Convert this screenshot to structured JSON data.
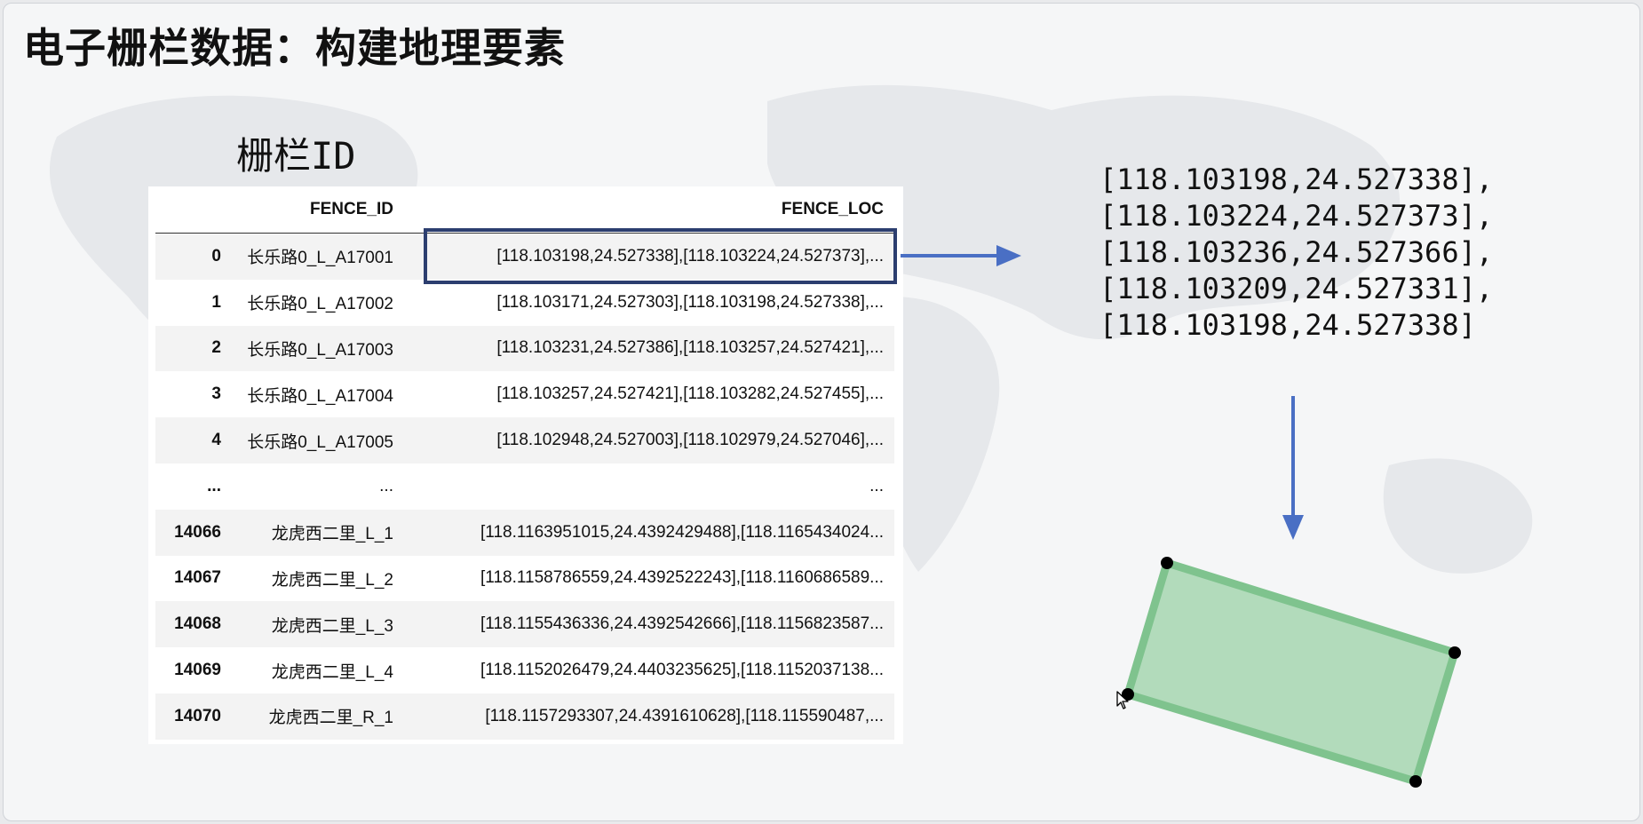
{
  "slide": {
    "title": "电子栅栏数据：构建地理要素",
    "fence_label": "栅栏ID"
  },
  "table": {
    "columns": [
      "",
      "FENCE_ID",
      "FENCE_LOC"
    ],
    "rows": [
      {
        "index": "0",
        "fence_id": "长乐路0_L_A17001",
        "fence_loc": "[118.103198,24.527338],[118.103224,24.527373],..."
      },
      {
        "index": "1",
        "fence_id": "长乐路0_L_A17002",
        "fence_loc": "[118.103171,24.527303],[118.103198,24.527338],..."
      },
      {
        "index": "2",
        "fence_id": "长乐路0_L_A17003",
        "fence_loc": "[118.103231,24.527386],[118.103257,24.527421],..."
      },
      {
        "index": "3",
        "fence_id": "长乐路0_L_A17004",
        "fence_loc": "[118.103257,24.527421],[118.103282,24.527455],..."
      },
      {
        "index": "4",
        "fence_id": "长乐路0_L_A17005",
        "fence_loc": "[118.102948,24.527003],[118.102979,24.527046],..."
      },
      {
        "index": "...",
        "fence_id": "...",
        "fence_loc": "..."
      },
      {
        "index": "14066",
        "fence_id": "龙虎西二里_L_1",
        "fence_loc": "[118.1163951015,24.4392429488],[118.1165434024..."
      },
      {
        "index": "14067",
        "fence_id": "龙虎西二里_L_2",
        "fence_loc": "[118.1158786559,24.4392522243],[118.1160686589..."
      },
      {
        "index": "14068",
        "fence_id": "龙虎西二里_L_3",
        "fence_loc": "[118.1155436336,24.4392542666],[118.1156823587..."
      },
      {
        "index": "14069",
        "fence_id": "龙虎西二里_L_4",
        "fence_loc": "[118.1152026479,24.4403235625],[118.1152037138..."
      },
      {
        "index": "14070",
        "fence_id": "龙虎西二里_R_1",
        "fence_loc": "[118.1157293307,24.4391610628],[118.115590487,..."
      }
    ]
  },
  "coordinates": [
    "[118.103198,24.527338],",
    "[118.103224,24.527373],",
    "[118.103236,24.527366],",
    "[118.103209,24.527331],",
    "[118.103198,24.527338]"
  ],
  "colors": {
    "arrow": "#4a6fc4",
    "highlight_border": "#2c3e6f",
    "polygon_fill": "#b2dbbb",
    "polygon_stroke": "#7fc38e",
    "vertex": "#000000"
  },
  "icons": {
    "flow_arrow": "arrow-right-icon",
    "down_arrow": "arrow-down-icon",
    "cursor": "mouse-cursor-icon"
  }
}
